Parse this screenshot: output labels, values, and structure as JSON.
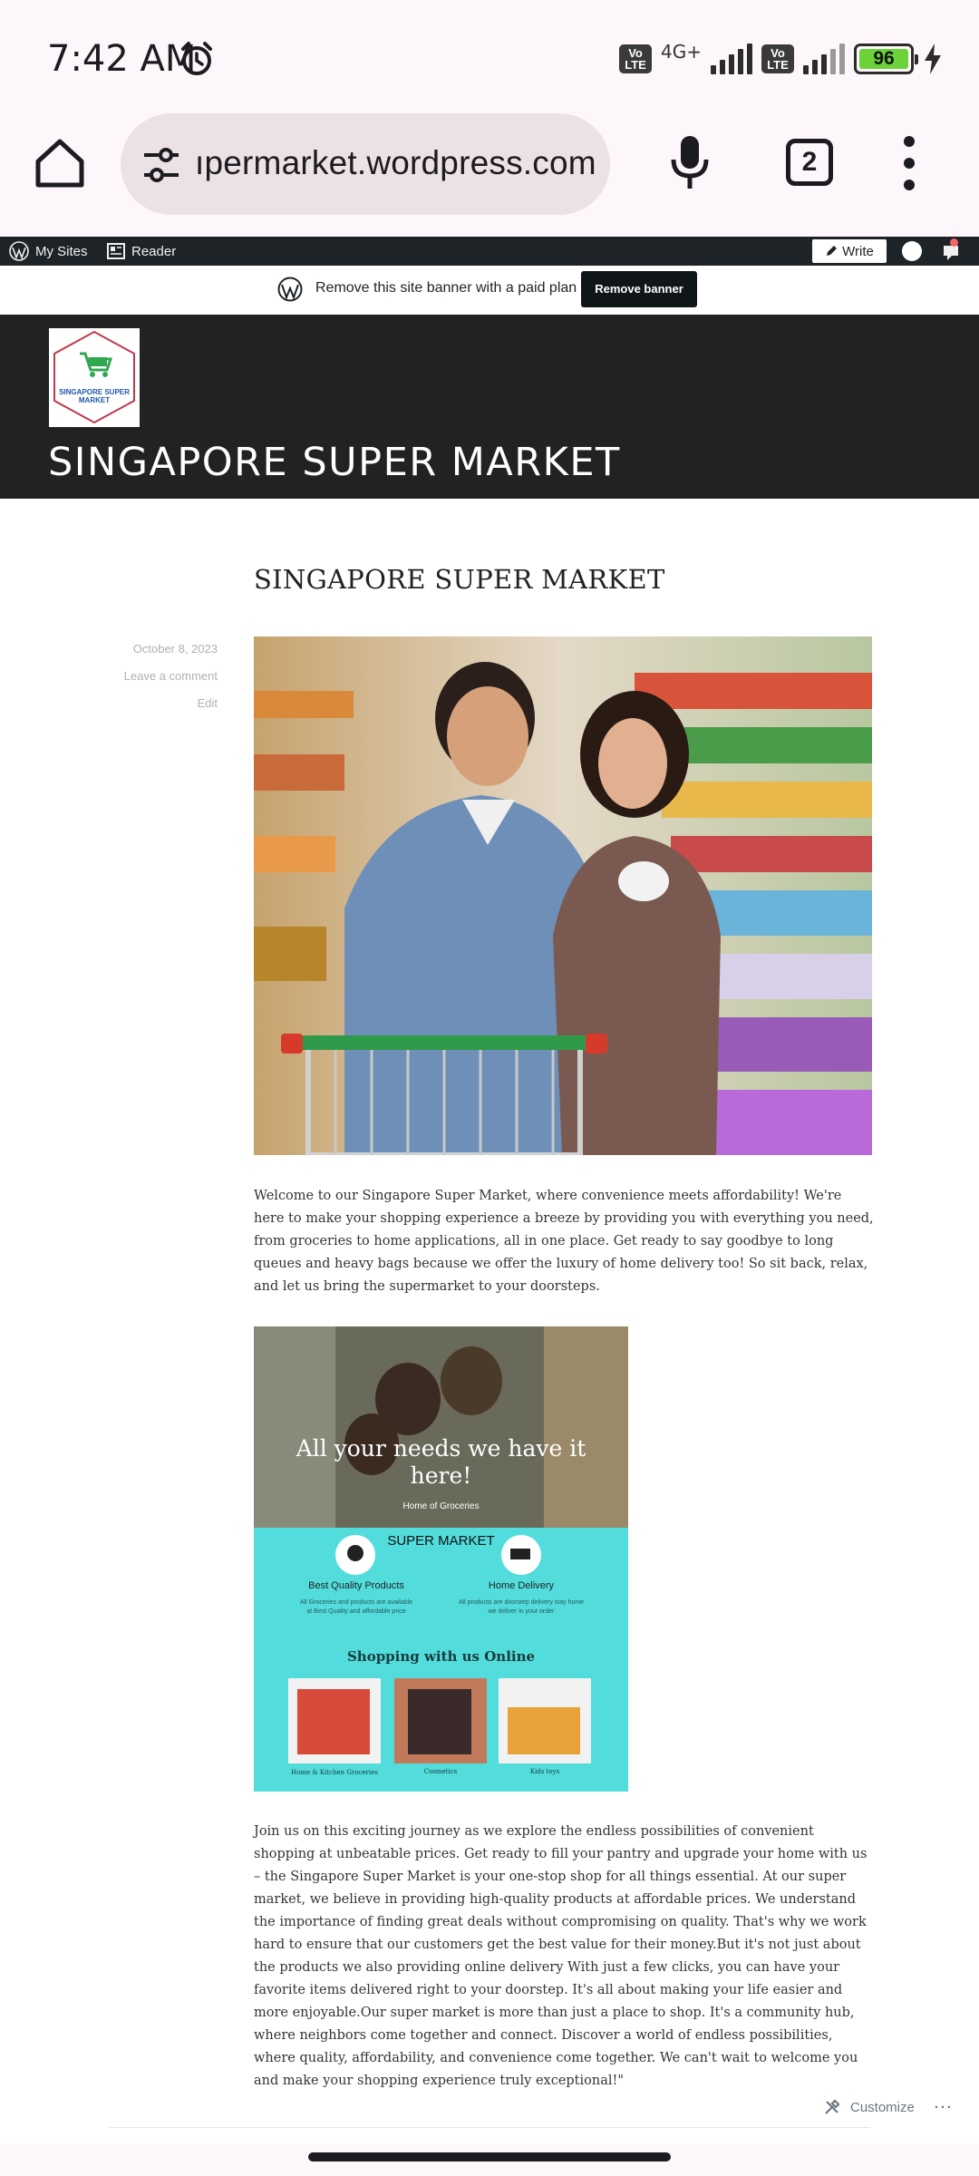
{
  "status_bar": {
    "time": "7:42 AM",
    "network": "4G+",
    "volte_1": "Vo LTE",
    "volte_2": "Vo LTE",
    "battery": "96"
  },
  "browser": {
    "url": "ıpermarket.wordpress.com",
    "tab_count": "2"
  },
  "wp_bar": {
    "my_sites": "My Sites",
    "reader": "Reader",
    "write": "Write"
  },
  "banner": {
    "text": "Remove this site banner with a paid plan",
    "button": "Remove banner"
  },
  "site": {
    "title": "SINGAPORE SUPER MARKET",
    "logo_text": "SINGAPORE SUPER MARKET"
  },
  "post": {
    "title": "SINGAPORE SUPER MARKET",
    "date": "October 8, 2023",
    "comment": "Leave a comment",
    "edit": "Edit",
    "para1": "Welcome to our Singapore Super Market, where convenience meets affordability! We're here to make your shopping experience a breeze by providing you with everything you need, from groceries to home applications, all in one place. Get ready to say goodbye to long queues and heavy bags because we offer the luxury of home delivery too! So sit back, relax, and let us bring the supermarket to your doorsteps.",
    "para2": "Join us on this exciting journey as we explore the endless possibilities of convenient shopping at un­beatable prices. Get ready to fill your pantry and upgrade your home with us – the Singapore Super Market is your one-stop shop for all things essential. At our super market, we believe in providing high-quality products at affordable prices. We understand the importance of finding great deals with­out compromising on quality. That's why we work hard to ensure that our customers get the best value for their money.But it's not just about the products we also providing online delivery With just a few clicks, you can have your favorite items delivered right to your doorstep. It's all about making your life easier and more enjoyable.Our super market is more than just a place to shop. It's a commu­nity hub, where neighbors come together and connect. Discover a world of endless possibilities, where quality, affordability, and convenience come together. We can't wait to welcome you and make your shopping experience truly exceptional!\""
  },
  "promo": {
    "headline": "All your needs we have it here!",
    "sub": "Home of Groceries",
    "brand": "SUPER MARKET",
    "feature1_title": "Best Quality Products",
    "feature1_text": "All Groceries and products are available at Best Quality and affordable price",
    "feature2_title": "Home Delivery",
    "feature2_text": "All products are doorstep delivery stay home we deliver in your order",
    "online": "Shopping with us Online",
    "cat1": "Home & Kitchen Groceries",
    "cat2": "Cosmetics",
    "cat3": "Kids toys"
  },
  "footer": {
    "customize": "Customize"
  },
  "colors": {
    "accent_dark": "#222222",
    "admin_bar": "#1d2327",
    "promo_teal": "#52dcdc",
    "battery_green": "#6cd23a"
  }
}
